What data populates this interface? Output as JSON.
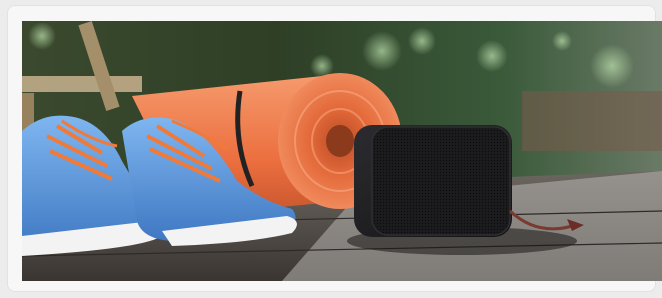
{
  "figure": {
    "image_label": "product-photo",
    "scene_items": [
      "sneakers-left",
      "sneakers-right",
      "yoga-mat",
      "bluetooth-speaker",
      "wooden-deck",
      "garden-background"
    ],
    "colors": {
      "background": "#ececec",
      "card": "#f7f7f7",
      "mat_orange": "#f07a4a",
      "shoe_blue": "#4f8fd6",
      "speaker_black": "#1d1d1f",
      "deck": "#4a453f"
    }
  }
}
